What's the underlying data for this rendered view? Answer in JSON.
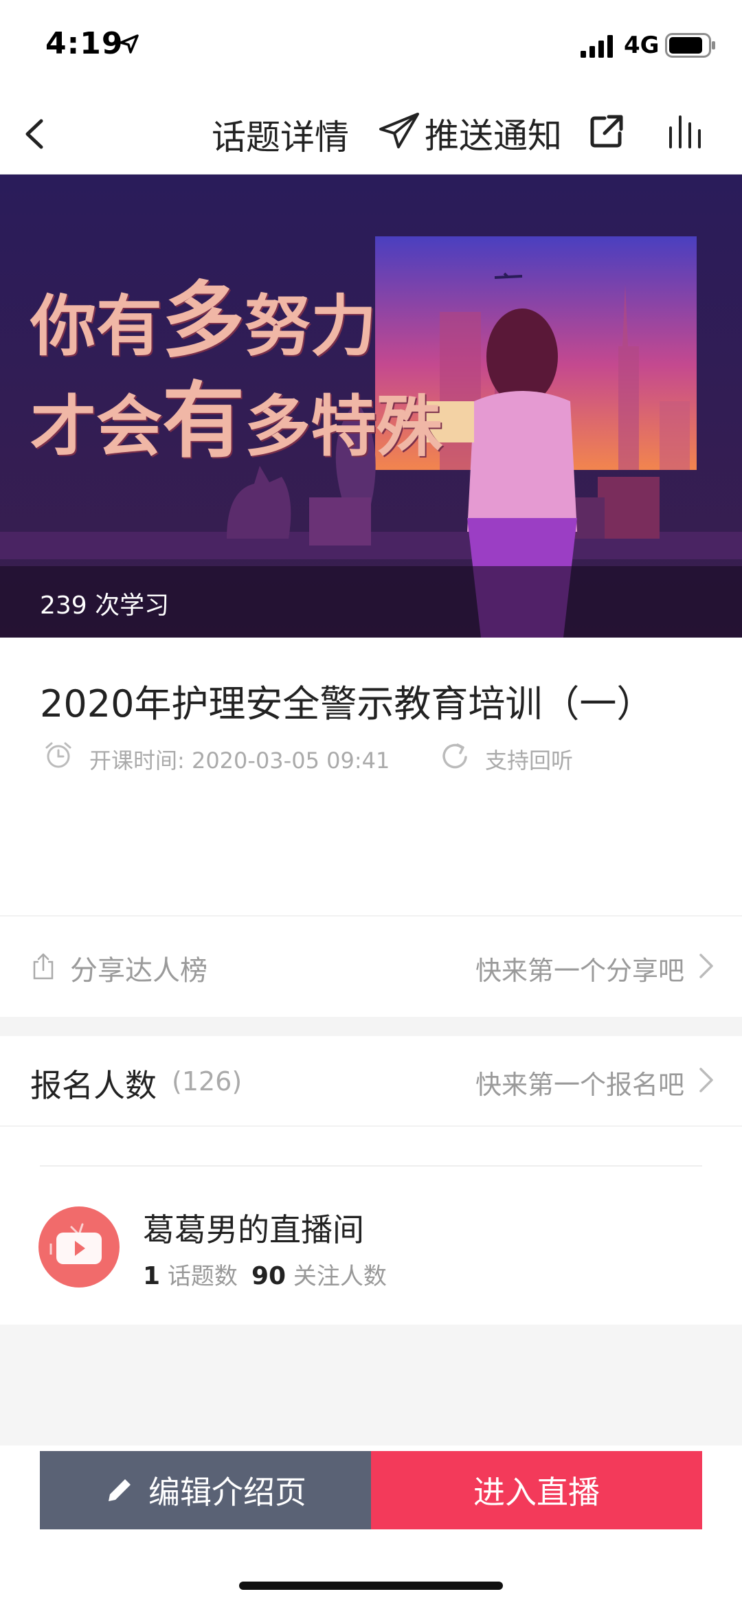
{
  "status_bar": {
    "time": "4:19",
    "network": "4G"
  },
  "nav": {
    "title": "话题详情",
    "push_label": "推送通知"
  },
  "banner": {
    "line1": [
      "你有",
      "多",
      "努力"
    ],
    "line2": [
      "才会",
      "有",
      "多特殊"
    ],
    "study_count": "239 次学习"
  },
  "course": {
    "title": "2020年护理安全警示教育培训（一）",
    "start_time": "开课时间: 2020-03-05 09:41",
    "replay": "支持回听"
  },
  "share_row": {
    "label": "分享达人榜",
    "hint": "快来第一个分享吧"
  },
  "signup_row": {
    "label": "报名人数",
    "count": "(126)",
    "hint": "快来第一个报名吧"
  },
  "channel": {
    "name": "葛葛男的直播间",
    "topics_num": "1",
    "topics_label": "话题数",
    "followers_num": "90",
    "followers_label": "关注人数"
  },
  "buttons": {
    "edit": "编辑介绍页",
    "live": "进入直播"
  },
  "colors": {
    "live_button": "#f33a5a",
    "edit_button": "#5a6275",
    "avatar": "#f16b6b"
  }
}
